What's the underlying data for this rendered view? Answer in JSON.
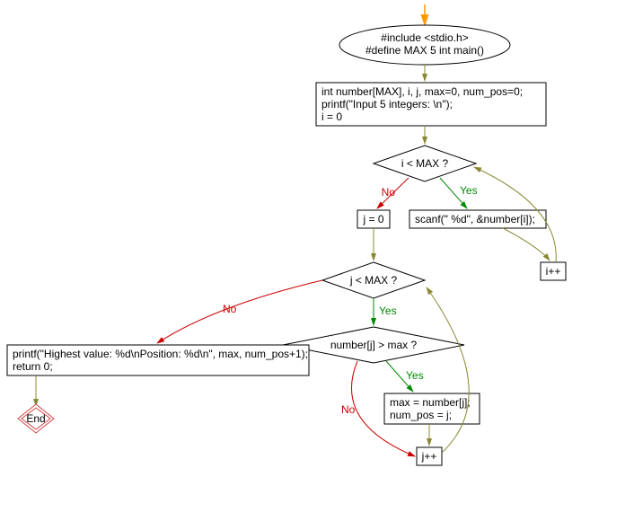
{
  "nodes": {
    "start": {
      "line1": "#include <stdio.h>",
      "line2": "#define MAX 5 int main()"
    },
    "init": {
      "line1": "int number[MAX], i, j, max=0, num_pos=0;",
      "line2": "printf(\"Input 5 integers: \\n\");",
      "line3": "i = 0"
    },
    "cond_i": "i < MAX ?",
    "scanf": "scanf(\" %d\", &number[i]);",
    "i_inc": "i++",
    "j_init": "j = 0",
    "cond_j": "j < MAX ?",
    "cond_num": "number[j] > max ?",
    "assign": {
      "line1": "max = number[j];",
      "line2": "num_pos = j;"
    },
    "j_inc": "j++",
    "printf": {
      "line1": "printf(\"Highest value: %d\\nPosition: %d\\n\", max, num_pos+1);",
      "line2": "return 0;"
    },
    "end": "End"
  },
  "labels": {
    "yes": "Yes",
    "no": "No"
  }
}
